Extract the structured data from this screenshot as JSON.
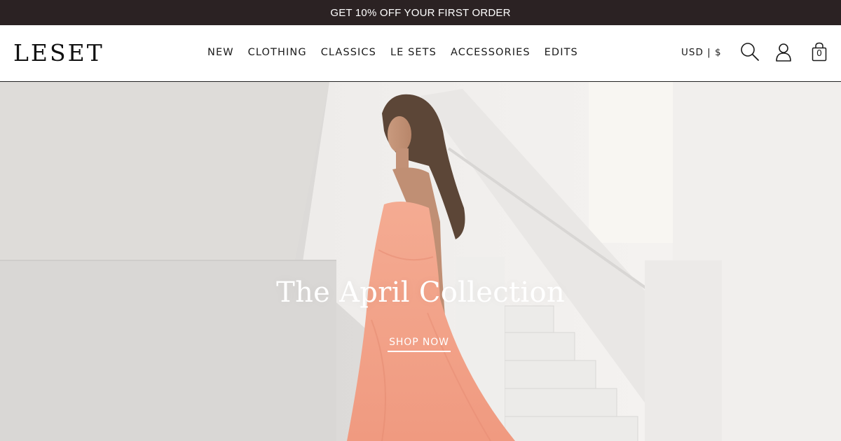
{
  "promo": {
    "text": "GET 10% OFF YOUR FIRST ORDER"
  },
  "header": {
    "logo": "LESET",
    "nav": [
      "NEW",
      "CLOTHING",
      "CLASSICS",
      "LE SETS",
      "ACCESSORIES",
      "EDITS"
    ],
    "currency": "USD | $",
    "cart_count": "0",
    "icons": [
      "search-icon",
      "account-icon",
      "shopping-bag-icon"
    ]
  },
  "hero": {
    "title": "The April Collection",
    "cta": "SHOP NOW"
  },
  "colors": {
    "promo_bg": "#2b2223",
    "text": "#1a1a1a",
    "dress": "#f2a48c",
    "white": "#ffffff"
  }
}
